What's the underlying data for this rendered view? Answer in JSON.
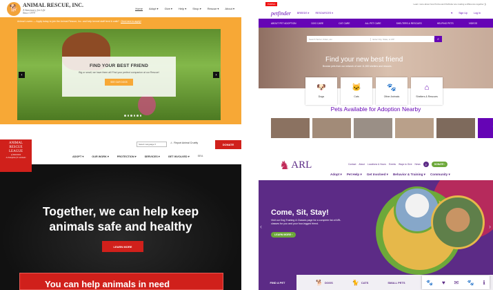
{
  "q1": {
    "logo_title": "ANIMAL RESCUE, INC.",
    "logo_sub1": "A Sanctuary for Life",
    "logo_sub2": "Since 1979",
    "nav": [
      "Home",
      "Adopt ▾",
      "Give ▾",
      "Help ▾",
      "Shop ▾",
      "Rescue ▾",
      "About ▾"
    ],
    "banner_text": "Animal Lovers — Apply today to join the Animal Rescue, Inc. and help kennel staff feed & walk?",
    "banner_link": "Click here to apply!",
    "card_title": "FIND YOUR BEST FRIEND",
    "card_text": "Big or small, we have them all! Find your perfect companion at our Rescue!",
    "card_button": "SEE OUR DOGS",
    "prev": "‹",
    "next": "›",
    "colors": {
      "accent": "#f7a836"
    }
  },
  "q2": {
    "top_notice": "Learn more about how Purina and Petfinder are making a difference together ❯",
    "purina": "PURINA",
    "logo": "petfinder",
    "hdr_breeds": "BREEDS ▾",
    "hdr_resources": "RESOURCES ▾",
    "sign_up": "Sign Up",
    "log_in": "Log In",
    "subnav": [
      "ABOUT PET ADOPTION",
      "DOG CARE",
      "CAT CARE",
      "ALL PET CARE",
      "SHELTERS & RESCUES",
      "HELPING PETS",
      "VIDEOS"
    ],
    "search_placeholder": "Search Terrier, Kitten, etc.",
    "location_placeholder": "Enter City, State, or ZIP",
    "hero_title": "Find your new best friend",
    "hero_sub": "Browse pets from our network of over 11,500 shelters and rescues.",
    "cards": [
      {
        "label": "Dogs",
        "icon": "dog-icon",
        "glyph": "🐶"
      },
      {
        "label": "Cats",
        "icon": "cat-icon",
        "glyph": "🐱"
      },
      {
        "label": "Other Animals",
        "icon": "paw-icon",
        "glyph": "🐾"
      },
      {
        "label": "Shelters & Rescues",
        "icon": "house-icon",
        "glyph": "⌂"
      }
    ],
    "available_title": "Pets Available for Adoption Nearby",
    "colors": {
      "accent": "#6504b5"
    }
  },
  "q3": {
    "logo_lines": [
      "ANIMAL",
      "RESCUE",
      "LEAGUE",
      "of BOSTON"
    ],
    "logo_tag": "A champion for animals",
    "language": "Select Language",
    "report": "Report Animal Cruelty",
    "donate": "DONATE",
    "menu": [
      "ADOPT ▾",
      "OUR WORK ▾",
      "PROTECTION ▾",
      "SERVICES ▾",
      "GET INVOLVED ▾",
      "SEA"
    ],
    "hero_line1": "Together, we can help keep",
    "hero_line2": "animals safe and healthy",
    "learn_more": "LEARN MORE",
    "bottom_text": "You can help animals in need",
    "colors": {
      "accent": "#d0201b"
    }
  },
  "q4": {
    "logo": "ARL",
    "logo_sub": "ANIMAL RESCUE LEAGUE",
    "utility": [
      "Contact",
      "About",
      "Locations & Hours",
      "Events",
      "Ways to Give",
      "News"
    ],
    "donate": "DONATE ›",
    "nav": [
      "Adopt ▾",
      "Pet Help ▾",
      "Get Involved ▾",
      "Behavior & Training ▾",
      "Community ▾"
    ],
    "hero_title": "Come, Sit, Stay!",
    "hero_text": "Visit our Dog Training & Classes page for a complete list of ARL classes for you and your four-legged friend.",
    "learn_more": "LEARN MORE ›",
    "find_pet": "FIND A PET",
    "dogs": "DOGS",
    "cats": "CATS",
    "small_pets": "SMALL PETS",
    "farm_pets": "FARM PETS",
    "colors": {
      "accent": "#5c2b86",
      "green": "#6da83a",
      "pink": "#c02a58"
    }
  }
}
